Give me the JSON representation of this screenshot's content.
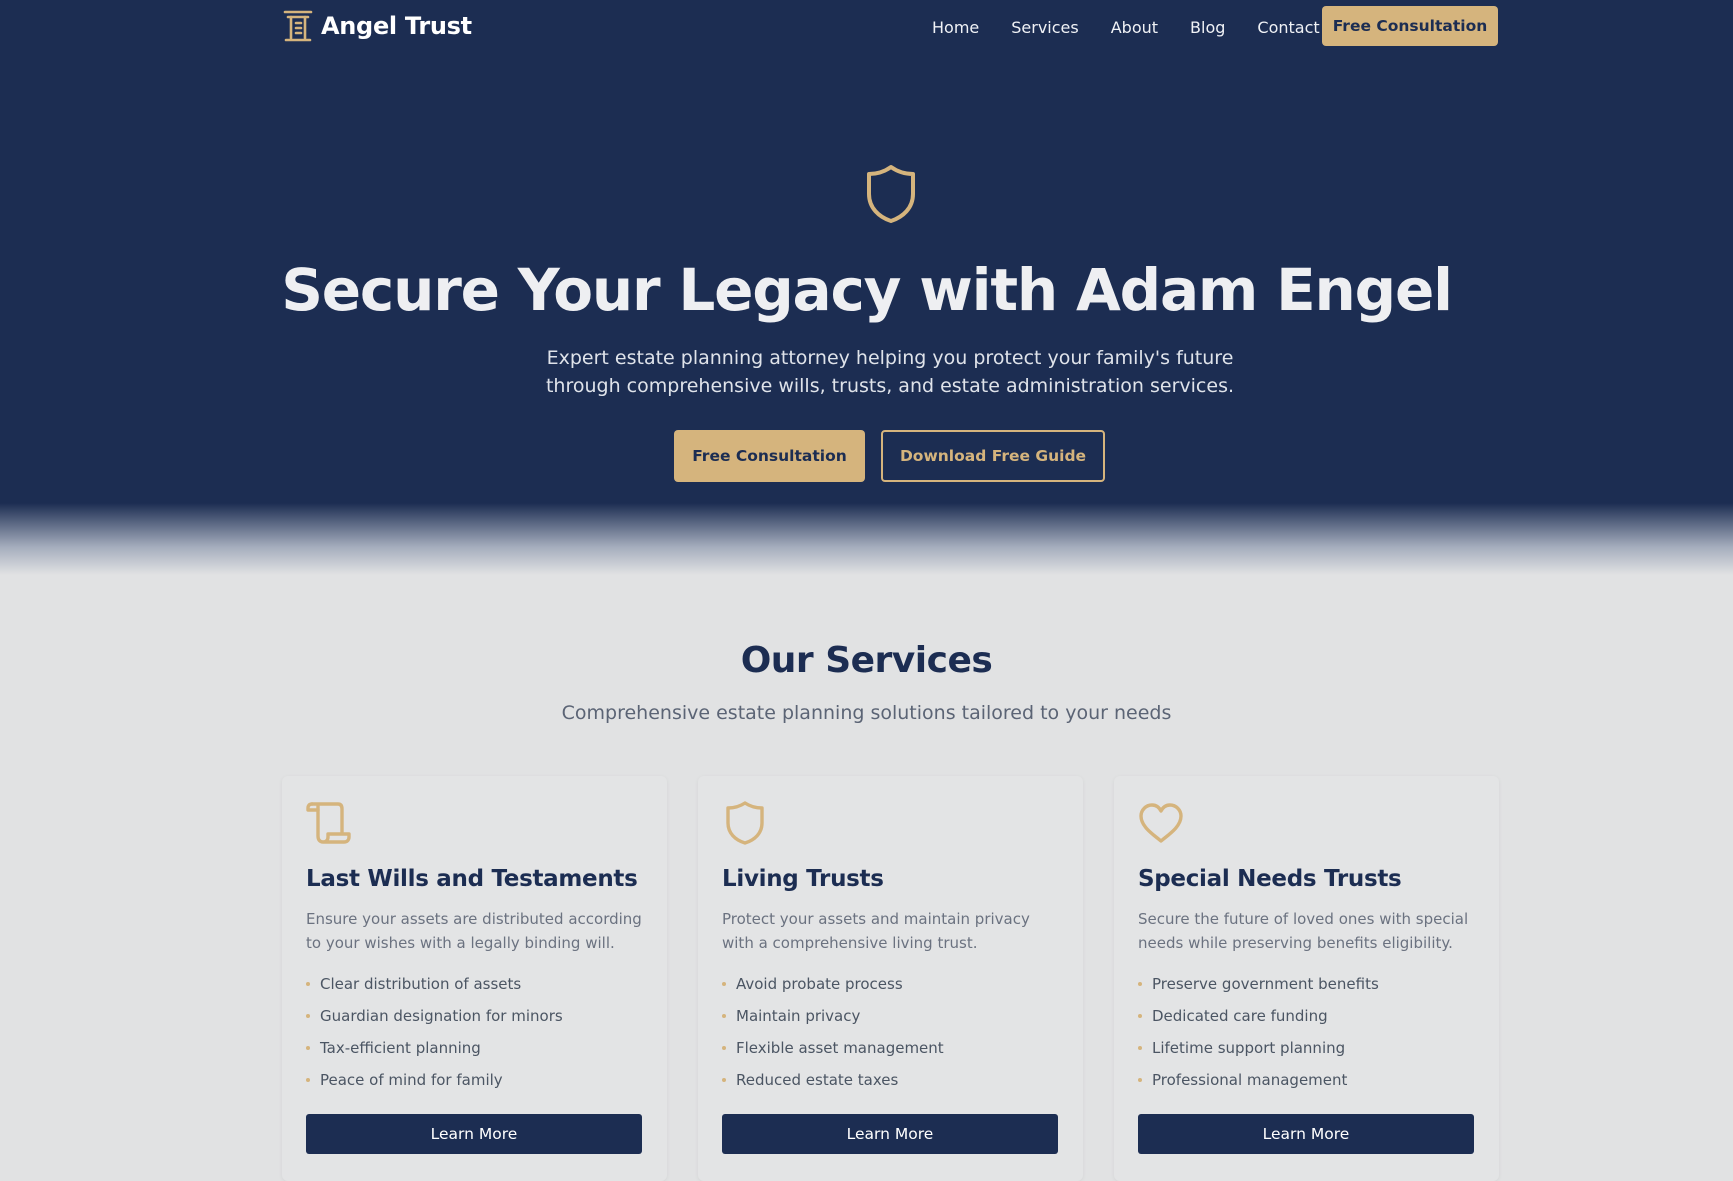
{
  "colors": {
    "navy": "#1c2d52",
    "gold": "#d5b47d",
    "background": "#e1e2e3"
  },
  "header": {
    "brand_icon": "column-icon",
    "brand_name": "Angel Trust",
    "nav": [
      "Home",
      "Services",
      "About",
      "Blog",
      "Contact"
    ],
    "cta": "Free Consultation"
  },
  "hero": {
    "icon": "shield-icon",
    "title": "Secure Your Legacy with Adam Engel",
    "subtitle": "Expert estate planning attorney helping you protect your family's future through comprehensive wills, trusts, and estate administration services.",
    "primary_button": "Free Consultation",
    "secondary_button": "Download Free Guide"
  },
  "services": {
    "title": "Our Services",
    "subtitle": "Comprehensive estate planning solutions tailored to your needs",
    "cards": [
      {
        "icon": "scroll-icon",
        "title": "Last Wills and Testaments",
        "description": "Ensure your assets are distributed according to your wishes with a legally binding will.",
        "features": [
          "Clear distribution of assets",
          "Guardian designation for minors",
          "Tax-efficient planning",
          "Peace of mind for family"
        ],
        "button": "Learn More"
      },
      {
        "icon": "shield-icon",
        "title": "Living Trusts",
        "description": "Protect your assets and maintain privacy with a comprehensive living trust.",
        "features": [
          "Avoid probate process",
          "Maintain privacy",
          "Flexible asset management",
          "Reduced estate taxes"
        ],
        "button": "Learn More"
      },
      {
        "icon": "heart-icon",
        "title": "Special Needs Trusts",
        "description": "Secure the future of loved ones with special needs while preserving benefits eligibility.",
        "features": [
          "Preserve government benefits",
          "Dedicated care funding",
          "Lifetime support planning",
          "Professional management"
        ],
        "button": "Learn More"
      }
    ]
  }
}
